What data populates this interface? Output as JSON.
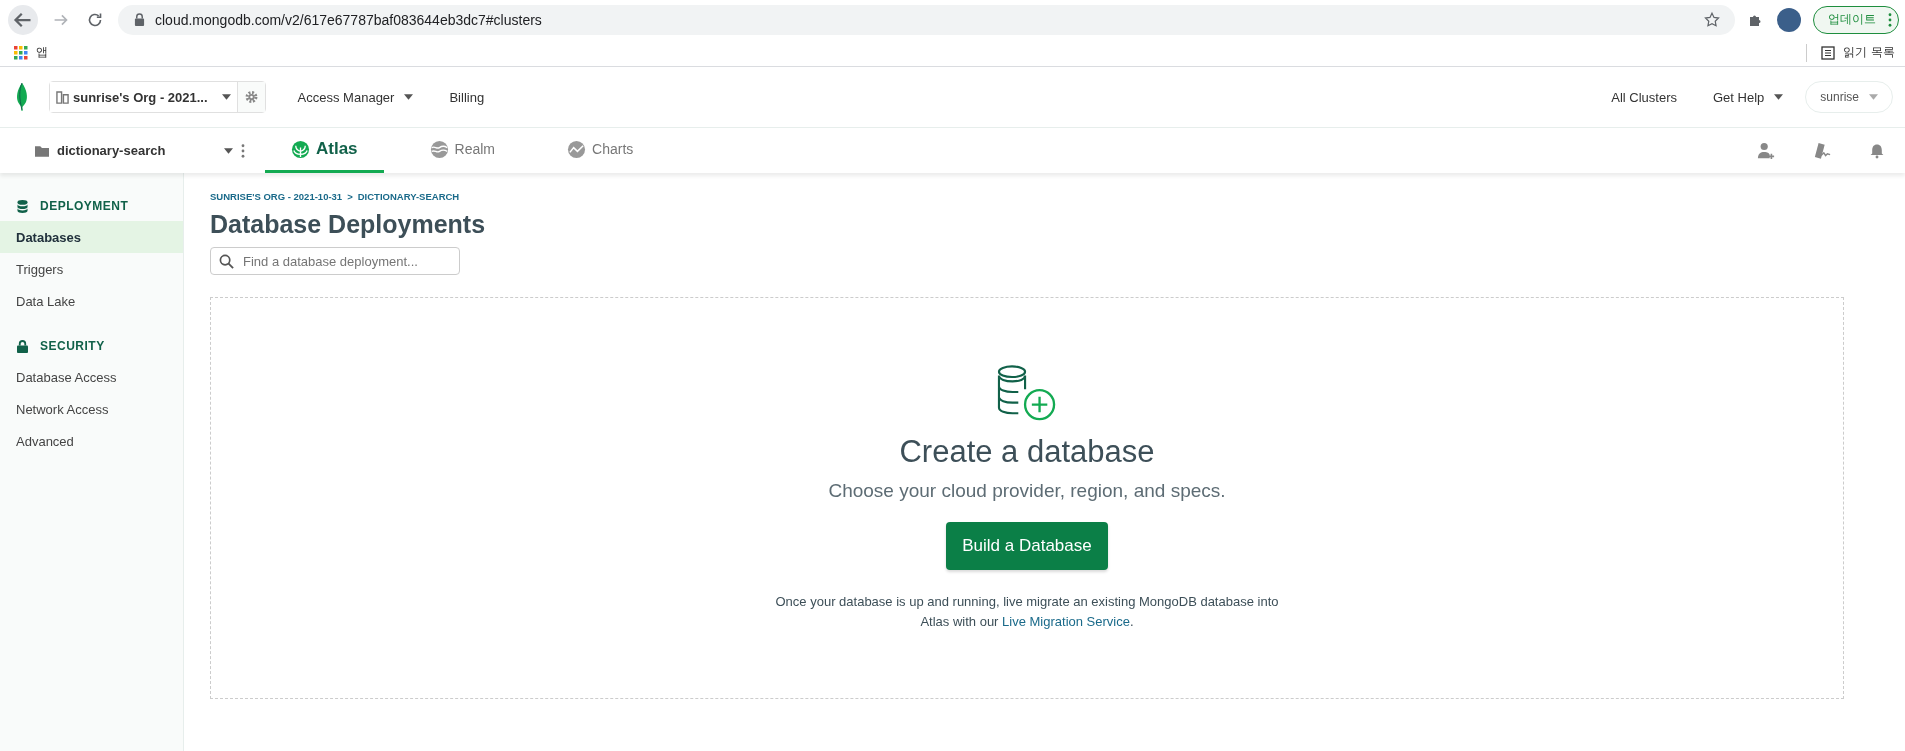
{
  "browser": {
    "url": "cloud.mongodb.com/v2/617e67787baf083644eb3dc7#clusters",
    "update_button": "업데이트",
    "bookmarks": [
      {
        "label": "앱"
      }
    ],
    "reading_list": "읽기 목록"
  },
  "top_nav": {
    "org": "sunrise's Org - 2021...",
    "links": [
      {
        "label": "Access Manager",
        "dropdown": true
      },
      {
        "label": "Billing",
        "dropdown": false
      }
    ],
    "right_links": [
      {
        "label": "All Clusters",
        "dropdown": false
      },
      {
        "label": "Get Help",
        "dropdown": true
      }
    ],
    "user": "sunrise"
  },
  "project_nav": {
    "project": "dictionary-search",
    "tabs": [
      {
        "label": "Atlas",
        "selected": true
      },
      {
        "label": "Realm",
        "selected": false
      },
      {
        "label": "Charts",
        "selected": false
      }
    ]
  },
  "sidebar": {
    "sections": [
      {
        "title": "DEPLOYMENT",
        "kind": "database",
        "items": [
          {
            "label": "Databases",
            "selected": true
          },
          {
            "label": "Triggers",
            "selected": false
          },
          {
            "label": "Data Lake",
            "selected": false
          }
        ]
      },
      {
        "title": "SECURITY",
        "kind": "lock",
        "items": [
          {
            "label": "Database Access",
            "selected": false
          },
          {
            "label": "Network Access",
            "selected": false
          },
          {
            "label": "Advanced",
            "selected": false
          }
        ]
      }
    ]
  },
  "breadcrumb": [
    {
      "label": "SUNRISE'S ORG - 2021-10-31"
    },
    {
      "label": "DICTIONARY-SEARCH"
    }
  ],
  "breadcrumb_separator": ">",
  "page_title": "Database Deployments",
  "search": {
    "placeholder": "Find a database deployment..."
  },
  "empty_state": {
    "title": "Create a database",
    "subtitle": "Choose your cloud provider, region, and specs.",
    "button": "Build a Database",
    "note": "Once your database is up and running, live migrate an existing MongoDB database into Atlas with our",
    "link": "Live Migration Service",
    "note_end": "."
  }
}
